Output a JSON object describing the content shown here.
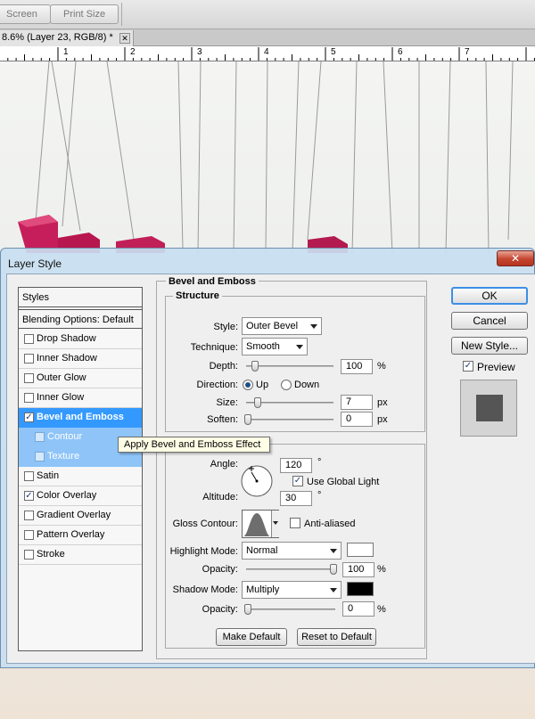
{
  "toolbar": {
    "screen_label": "Screen",
    "print_size_label": "Print Size"
  },
  "document_tab": {
    "title": "8.6% (Layer 23, RGB/8) *",
    "close_glyph": "✕"
  },
  "ruler": {
    "labels": [
      "1",
      "2",
      "3",
      "4",
      "5",
      "6",
      "7"
    ]
  },
  "dialog": {
    "title": "Layer Style",
    "close_glyph": "✕",
    "styles_list": {
      "header": "Styles",
      "blending_options": "Blending Options: Default",
      "items": [
        {
          "label": "Drop Shadow",
          "checked": false
        },
        {
          "label": "Inner Shadow",
          "checked": false
        },
        {
          "label": "Outer Glow",
          "checked": false
        },
        {
          "label": "Inner Glow",
          "checked": false
        },
        {
          "label": "Bevel and Emboss",
          "checked": true
        },
        {
          "label": "Contour",
          "checked": false
        },
        {
          "label": "Texture",
          "checked": false
        },
        {
          "label": "Satin",
          "checked": false
        },
        {
          "label": "Color Overlay",
          "checked": true
        },
        {
          "label": "Gradient Overlay",
          "checked": false
        },
        {
          "label": "Pattern Overlay",
          "checked": false
        },
        {
          "label": "Stroke",
          "checked": false
        }
      ]
    },
    "bevel": {
      "group_title": "Bevel and Emboss",
      "structure_title": "Structure",
      "style_label": "Style:",
      "style_value": "Outer Bevel",
      "technique_label": "Technique:",
      "technique_value": "Smooth",
      "depth_label": "Depth:",
      "depth_value": "100",
      "depth_unit": "%",
      "direction_label": "Direction:",
      "direction_up": "Up",
      "direction_down": "Down",
      "size_label": "Size:",
      "size_value": "7",
      "size_unit": "px",
      "soften_label": "Soften:",
      "soften_value": "0",
      "soften_unit": "px"
    },
    "shading": {
      "angle_label": "Angle:",
      "angle_value": "120",
      "degree": "°",
      "use_global_light": "Use Global Light",
      "altitude_label": "Altitude:",
      "altitude_value": "30",
      "gloss_contour_label": "Gloss Contour:",
      "anti_aliased": "Anti-aliased",
      "highlight_mode_label": "Highlight Mode:",
      "highlight_mode_value": "Normal",
      "highlight_color": "#ffffff",
      "highlight_opacity_label": "Opacity:",
      "highlight_opacity_value": "100",
      "shadow_mode_label": "Shadow Mode:",
      "shadow_mode_value": "Multiply",
      "shadow_color": "#000000",
      "shadow_opacity_label": "Opacity:",
      "shadow_opacity_value": "0",
      "percent": "%"
    },
    "buttons": {
      "make_default": "Make Default",
      "reset_to_default": "Reset to Default",
      "ok": "OK",
      "cancel": "Cancel",
      "new_style": "New Style...",
      "preview": "Preview"
    },
    "tooltip": "Apply Bevel and Emboss Effect"
  },
  "colors": {
    "selection": "#3399ff",
    "sub_selection": "#8ec4f8",
    "title_bar": "#c8def0",
    "close_red": "#c4452f"
  }
}
